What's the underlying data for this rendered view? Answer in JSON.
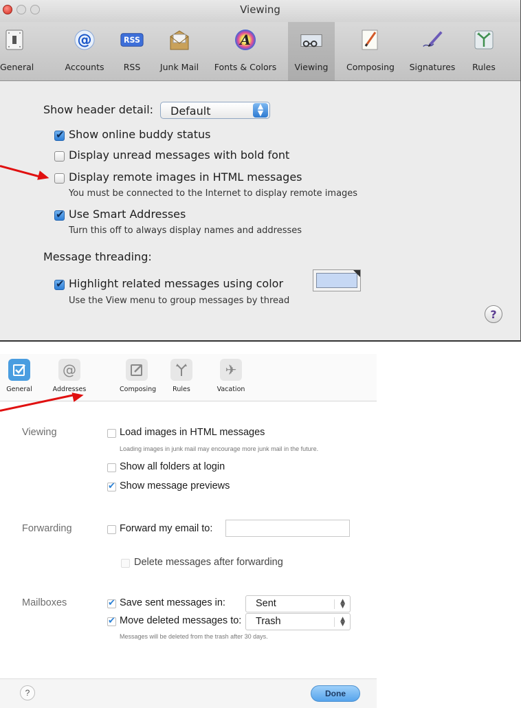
{
  "mac_prefs": {
    "window_title": "Viewing",
    "toolbar": [
      {
        "label": "General",
        "icon": "general-switch-icon"
      },
      {
        "label": "Accounts",
        "icon": "at-sign-icon"
      },
      {
        "label": "RSS",
        "icon": "rss-icon"
      },
      {
        "label": "Junk Mail",
        "icon": "junk-mail-icon"
      },
      {
        "label": "Fonts & Colors",
        "icon": "fonts-colors-icon"
      },
      {
        "label": "Viewing",
        "icon": "viewing-glasses-icon"
      },
      {
        "label": "Composing",
        "icon": "pencil-icon"
      },
      {
        "label": "Signatures",
        "icon": "signature-pen-icon"
      },
      {
        "label": "Rules",
        "icon": "rules-arrows-icon"
      }
    ],
    "selected_tab": "Viewing",
    "show_header_detail_label": "Show header detail:",
    "show_header_detail_value": "Default",
    "options": [
      {
        "label": "Show online buddy status",
        "checked": true
      },
      {
        "label": "Display unread messages with bold font",
        "checked": false
      },
      {
        "label": "Display remote images in HTML messages",
        "checked": false
      },
      {
        "label": "Use Smart Addresses",
        "checked": true
      }
    ],
    "remote_images_note": "You must be connected to the Internet to display remote images",
    "smart_addresses_note": "Turn this off to always display names and addresses",
    "message_threading_label": "Message threading:",
    "highlight_label": "Highlight related messages using color",
    "highlight_checked": true,
    "highlight_color": "#c6d8f4",
    "highlight_note": "Use the View menu to group messages by thread",
    "help_label": "?"
  },
  "web_prefs": {
    "tabs": [
      {
        "label": "General",
        "icon": "checkbox-icon"
      },
      {
        "label": "Addresses",
        "icon": "at-sign-icon"
      },
      {
        "label": "Composing",
        "icon": "compose-icon"
      },
      {
        "label": "Rules",
        "icon": "rules-arrows-icon"
      },
      {
        "label": "Vacation",
        "icon": "airplane-icon"
      }
    ],
    "selected_tab": "General",
    "viewing": {
      "section_label": "Viewing",
      "load_images_label": "Load images in HTML messages",
      "load_images_checked": false,
      "load_images_note": "Loading images in junk mail may encourage more junk mail in the future.",
      "show_folders_label": "Show all folders at login",
      "show_folders_checked": false,
      "show_previews_label": "Show message previews",
      "show_previews_checked": true
    },
    "forwarding": {
      "section_label": "Forwarding",
      "forward_label": "Forward my email to:",
      "forward_checked": false,
      "forward_value": "",
      "delete_after_label": "Delete messages after forwarding",
      "delete_after_checked": false
    },
    "mailboxes": {
      "section_label": "Mailboxes",
      "save_sent_label": "Save sent messages in:",
      "save_sent_checked": true,
      "save_sent_value": "Sent",
      "move_deleted_label": "Move deleted messages to:",
      "move_deleted_checked": true,
      "move_deleted_value": "Trash",
      "trash_note": "Messages will be deleted from the trash after 30 days."
    },
    "help_label": "?",
    "done_label": "Done"
  },
  "annotation_color": "#e01010"
}
